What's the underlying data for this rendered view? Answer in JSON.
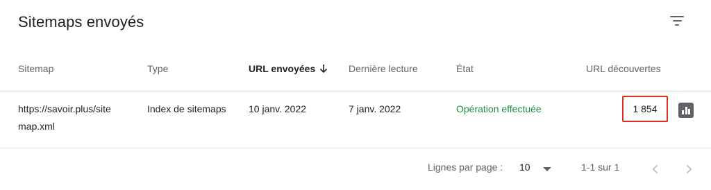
{
  "header": {
    "title": "Sitemaps envoyés",
    "filter_icon": "filter-list-icon"
  },
  "table": {
    "columns": [
      "Sitemap",
      "Type",
      "URL envoyées",
      "Dernière lecture",
      "État",
      "URL découvertes"
    ],
    "sorted_column": "URL envoyées",
    "sort_direction": "descending",
    "rows": [
      {
        "sitemap": "https://savoir.plus/sitemap.xml",
        "sitemap_line1": "https://savoir.plus/site",
        "sitemap_line2": "map.xml",
        "type": "Index de sitemaps",
        "submitted": "10 janv. 2022",
        "last_read": "7 janv. 2022",
        "status": "Opération effectuée",
        "discovered": "1 854",
        "chart_icon": "bar-chart-icon"
      }
    ]
  },
  "footer": {
    "rows_per_page_label": "Lignes par page :",
    "rows_per_page_value": "10",
    "range": "1-1 sur 1"
  },
  "colors": {
    "status_success": "#1e8e3e",
    "highlight_border": "#d93025",
    "icon_gray": "#5f6368"
  }
}
